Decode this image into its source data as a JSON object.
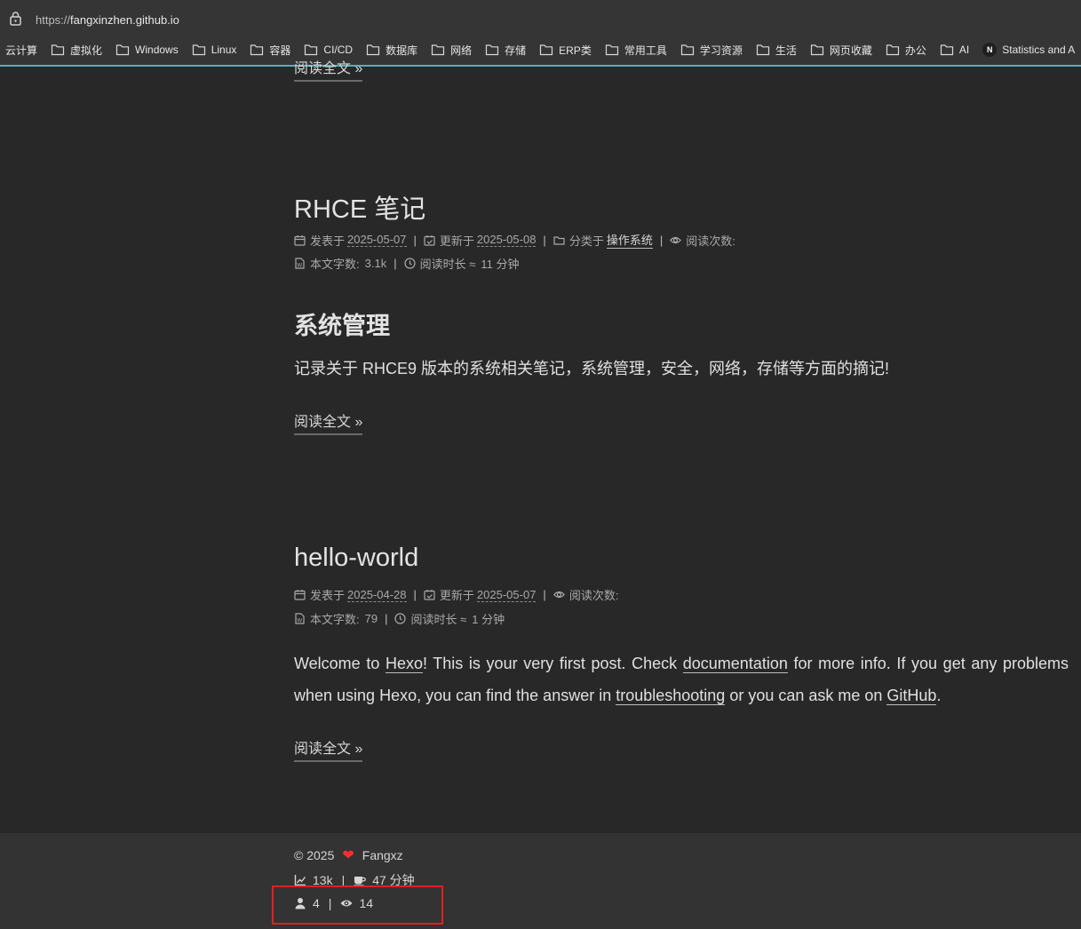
{
  "browser": {
    "url_scheme": "https://",
    "url_host": "fangxinzhen.github.io",
    "bookmarks": [
      {
        "label": "云计算",
        "icon": "none"
      },
      {
        "label": "虚拟化",
        "icon": "folder-icon"
      },
      {
        "label": "Windows",
        "icon": "folder-icon"
      },
      {
        "label": "Linux",
        "icon": "folder-icon"
      },
      {
        "label": "容器",
        "icon": "folder-icon"
      },
      {
        "label": "CI/CD",
        "icon": "folder-icon"
      },
      {
        "label": "数据库",
        "icon": "folder-icon"
      },
      {
        "label": "网络",
        "icon": "folder-icon"
      },
      {
        "label": "存储",
        "icon": "folder-icon"
      },
      {
        "label": "ERP类",
        "icon": "folder-icon"
      },
      {
        "label": "常用工具",
        "icon": "folder-icon"
      },
      {
        "label": "学习资源",
        "icon": "folder-icon"
      },
      {
        "label": "生活",
        "icon": "folder-icon"
      },
      {
        "label": "网页收藏",
        "icon": "folder-icon"
      },
      {
        "label": "办公",
        "icon": "folder-icon"
      },
      {
        "label": "AI",
        "icon": "folder-icon"
      },
      {
        "label": "Statistics and A",
        "icon": "n-badge-icon",
        "badge": "N"
      }
    ],
    "accent_color": "#4fb3b7"
  },
  "prev_post": {
    "read_more": "阅读全文 »"
  },
  "posts": [
    {
      "title": "RHCE 笔记",
      "posted_label": "发表于",
      "posted_date": "2025-05-07",
      "updated_label": "更新于",
      "updated_date": "2025-05-08",
      "category_label": "分类于",
      "category": "操作系统",
      "views_label": "阅读次数:",
      "words_label": "本文字数:",
      "words": "3.1k",
      "read_time_label": "阅读时长 ≈",
      "read_time": "11 分钟",
      "heading": "系统管理",
      "excerpt": "记录关于 RHCE9 版本的系统相关笔记，系统管理，安全，网络，存储等方面的摘记!",
      "read_more": "阅读全文 »"
    },
    {
      "title": "hello-world",
      "posted_label": "发表于",
      "posted_date": "2025-04-28",
      "updated_label": "更新于",
      "updated_date": "2025-05-07",
      "views_label": "阅读次数:",
      "words_label": "本文字数:",
      "words": "79",
      "read_time_label": "阅读时长 ≈",
      "read_time": "1 分钟",
      "excerpt_parts": {
        "t1": "Welcome to ",
        "link1": "Hexo",
        "t2": "! This is your very first post. Check ",
        "link2": "documentation",
        "t3": " for more info. If you get any problems when using Hexo, you can find the answer in ",
        "link3": "troubleshooting",
        "t4": " or you can ask me on ",
        "link4": "GitHub",
        "t5": "."
      },
      "read_more": "阅读全文 »"
    }
  ],
  "footer": {
    "copyright": "© 2025",
    "author": "Fangxz",
    "heart": "❤",
    "total_words": "13k",
    "total_time": "47 分钟",
    "visitors": "4",
    "page_views": "14",
    "sep": "|",
    "heart_color": "#ff2d2d",
    "highlight_color": "#e02020"
  }
}
